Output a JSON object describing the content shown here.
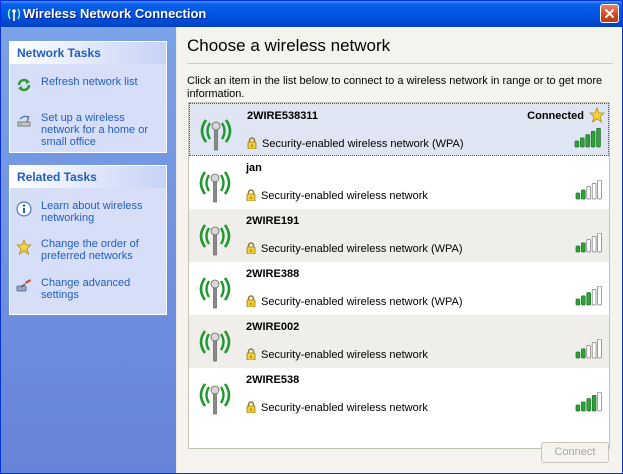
{
  "window": {
    "title": "Wireless Network Connection"
  },
  "sidebar": {
    "network_tasks": {
      "header": "Network Tasks",
      "items": [
        {
          "label": "Refresh network list",
          "icon": "refresh-icon"
        },
        {
          "label": "Set up a wireless network for a home or small office",
          "icon": "setup-network-icon"
        }
      ]
    },
    "related_tasks": {
      "header": "Related Tasks",
      "items": [
        {
          "label": "Learn about wireless networking",
          "icon": "info-icon"
        },
        {
          "label": "Change the order of preferred networks",
          "icon": "star-icon"
        },
        {
          "label": "Change advanced settings",
          "icon": "settings-icon"
        }
      ]
    }
  },
  "main": {
    "heading": "Choose a wireless network",
    "description": "Click an item in the list below to connect to a wireless network in range or to get more information.",
    "networks": [
      {
        "ssid": "2WIRE538311",
        "security": "Security-enabled wireless network (WPA)",
        "status": "Connected",
        "signal_bars": 5
      },
      {
        "ssid": "jan",
        "security": "Security-enabled wireless network",
        "status": "",
        "signal_bars": 2
      },
      {
        "ssid": "2WIRE191",
        "security": "Security-enabled wireless network (WPA)",
        "status": "",
        "signal_bars": 2
      },
      {
        "ssid": "2WIRE388",
        "security": "Security-enabled wireless network (WPA)",
        "status": "",
        "signal_bars": 3
      },
      {
        "ssid": "2WIRE002",
        "security": "Security-enabled wireless network",
        "status": "",
        "signal_bars": 2
      },
      {
        "ssid": "2WIRE538",
        "security": "Security-enabled wireless network",
        "status": "",
        "signal_bars": 4
      }
    ],
    "connect_label": "Connect"
  },
  "colors": {
    "titlebar": "#0055e5",
    "sidebar": "#7ba1e7",
    "link": "#215dc6",
    "signal_on": "#2fa33a",
    "signal_off": "#ffffff"
  }
}
